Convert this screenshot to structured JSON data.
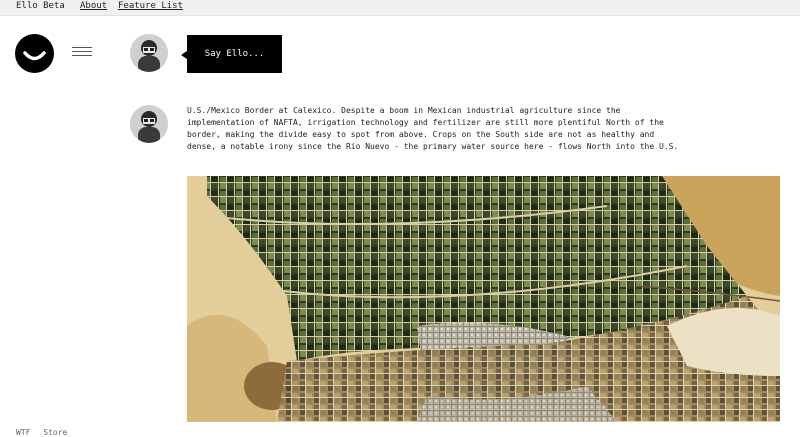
{
  "topbar": {
    "brand": "Ello Beta",
    "about": "About",
    "features": "Feature List"
  },
  "composer": {
    "button_label": "Say Ello..."
  },
  "post": {
    "text": "U.S./Mexico Border at Calexico. Despite a boom in Mexican industrial agriculture since the implementation of NAFTA, irrigation technology and fertilizer are still more plentiful North of the border, making the divide easy to spot from above. Crops on the South side are not as healthy and dense, a notable irony since the Rio Nuevo - the primary water source here - flows North into the U.S."
  },
  "footer": {
    "wtf": "WTF",
    "store": "Store"
  },
  "icons": {
    "logo": "ello-smile-icon",
    "menu": "hamburger-menu-icon"
  }
}
